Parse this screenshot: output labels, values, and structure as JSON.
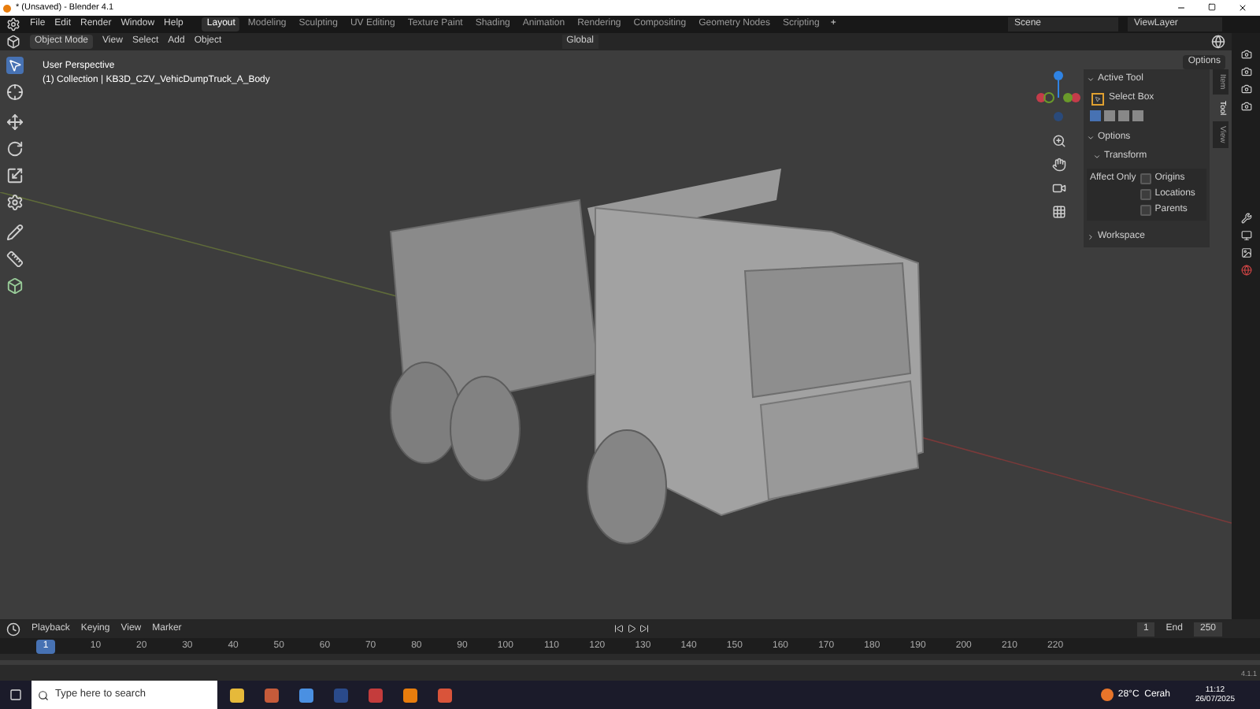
{
  "window": {
    "title": "* (Unsaved) - Blender 4.1"
  },
  "menu": [
    "File",
    "Edit",
    "Render",
    "Window",
    "Help"
  ],
  "workspaces": [
    {
      "label": "Layout",
      "selected": true
    },
    {
      "label": "Modeling",
      "selected": false
    },
    {
      "label": "Sculpting",
      "selected": false
    },
    {
      "label": "UV Editing",
      "selected": false
    },
    {
      "label": "Texture Paint",
      "selected": false
    },
    {
      "label": "Shading",
      "selected": false
    },
    {
      "label": "Animation",
      "selected": false
    },
    {
      "label": "Rendering",
      "selected": false
    },
    {
      "label": "Compositing",
      "selected": false
    },
    {
      "label": "Geometry Nodes",
      "selected": false
    },
    {
      "label": "Scripting",
      "selected": false
    }
  ],
  "add_workspace": "+",
  "scene": "Scene",
  "view_layer": "ViewLayer",
  "header": {
    "mode": "Object Mode",
    "menus": [
      "View",
      "Select",
      "Add",
      "Object"
    ],
    "orientation": "Global",
    "options": "Options"
  },
  "viewport": {
    "title": "User Perspective",
    "object": "(1) Collection | KB3D_CZV_VehicDumpTruck_A_Body"
  },
  "sidebar": {
    "tabs": [
      {
        "label": "Item",
        "selected": false
      },
      {
        "label": "Tool",
        "selected": true
      },
      {
        "label": "View",
        "selected": false
      }
    ],
    "active_tool": "Active Tool",
    "tool": "Select Box",
    "options": "Options",
    "transform": "Transform",
    "affect_only": "Affect Only",
    "checks": [
      {
        "label": "Origins",
        "checked": false
      },
      {
        "label": "Locations",
        "checked": false
      },
      {
        "label": "Parents",
        "checked": false
      }
    ],
    "workspace": "Workspace"
  },
  "timeline": {
    "menus": [
      "Playback",
      "Keying",
      "View",
      "Marker"
    ],
    "current": "1",
    "start": "1",
    "end_label": "End",
    "end": "250",
    "frames": [
      "10",
      "20",
      "30",
      "40",
      "50",
      "60",
      "70",
      "80",
      "90",
      "100",
      "110",
      "120",
      "130",
      "140",
      "150",
      "160",
      "170",
      "180",
      "190",
      "200",
      "210",
      "220"
    ]
  },
  "version": "4.1.1",
  "taskbar": {
    "search": "Type here to search",
    "weather": "28°C  Cerah",
    "time": "11:12",
    "date": "26/07/2025"
  }
}
